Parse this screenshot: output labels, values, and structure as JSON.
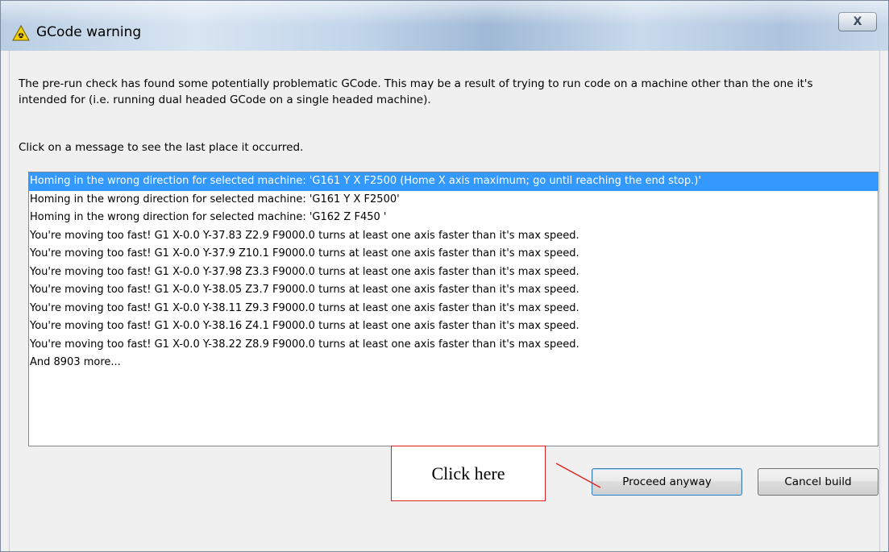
{
  "window": {
    "title": "GCode warning",
    "close_label": "X",
    "title_icon": "warning-triangle-icon"
  },
  "message": {
    "intro": "The pre-run check has found some potentially problematic GCode. This may be a result of trying to run code on a machine other than the one it's intended for (i.e. running dual headed GCode on a single headed machine).",
    "instruction": "Click on a message to see the last place it occurred."
  },
  "warnings": [
    "Homing in the wrong direction for selected machine: 'G161 Y X F2500 (Home X axis maximum; go until reaching the end stop.)'",
    "Homing in the wrong direction for selected machine: 'G161 Y X F2500'",
    "Homing in the wrong direction for selected machine: 'G162 Z F450 '",
    "You're moving too fast! G1 X-0.0 Y-37.83 Z2.9 F9000.0 turns at least one axis faster than it's max speed.",
    "You're moving too fast! G1 X-0.0 Y-37.9 Z10.1 F9000.0 turns at least one axis faster than it's max speed.",
    "You're moving too fast! G1 X-0.0 Y-37.98 Z3.3 F9000.0 turns at least one axis faster than it's max speed.",
    "You're moving too fast! G1 X-0.0 Y-38.05 Z3.7 F9000.0 turns at least one axis faster than it's max speed.",
    "You're moving too fast! G1 X-0.0 Y-38.11 Z9.3 F9000.0 turns at least one axis faster than it's max speed.",
    "You're moving too fast! G1 X-0.0 Y-38.16 Z4.1 F9000.0 turns at least one axis faster than it's max speed.",
    "You're moving too fast! G1 X-0.0 Y-38.22 Z8.9 F9000.0 turns at least one axis faster than it's max speed.",
    "And 8903 more..."
  ],
  "selected_index": 0,
  "buttons": {
    "proceed": "Proceed anyway",
    "cancel": "Cancel build"
  },
  "annotation": {
    "text": "Click here",
    "color": "#e02020"
  },
  "colors": {
    "selection": "#3399ff"
  }
}
